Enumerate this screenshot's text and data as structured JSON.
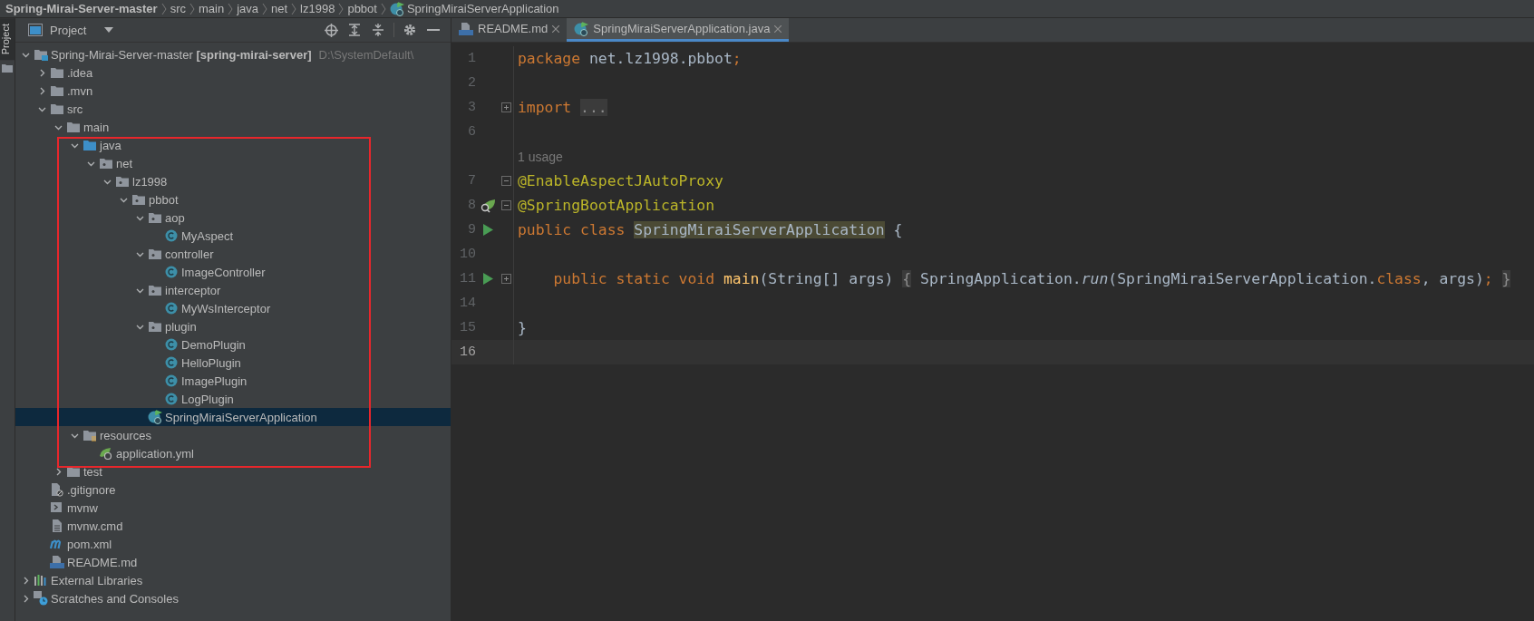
{
  "breadcrumb": [
    {
      "label": "Spring-Mirai-Server-master",
      "bold": true,
      "kind": "text"
    },
    {
      "label": "src",
      "bold": false,
      "kind": "text"
    },
    {
      "label": "main",
      "bold": false,
      "kind": "text"
    },
    {
      "label": "java",
      "bold": false,
      "kind": "text"
    },
    {
      "label": "net",
      "bold": false,
      "kind": "text"
    },
    {
      "label": "lz1998",
      "bold": false,
      "kind": "text"
    },
    {
      "label": "pbbot",
      "bold": false,
      "kind": "text"
    },
    {
      "label": "SpringMiraiServerApplication",
      "bold": false,
      "kind": "spring-class"
    }
  ],
  "side_strip": {
    "tabs": [
      {
        "label": "Project",
        "selected": true
      }
    ]
  },
  "project_panel": {
    "title": "Project",
    "tree": [
      {
        "label": "Spring-Mirai-Server-master **[spring-mirai-server]**",
        "path": "D:\\SystemDefault\\",
        "kind": "module",
        "expanded": true,
        "selected": false,
        "children": [
          {
            "label": ".idea",
            "kind": "folder",
            "expanded": false,
            "selected": false
          },
          {
            "label": ".mvn",
            "kind": "folder",
            "expanded": false,
            "selected": false
          },
          {
            "label": "src",
            "kind": "folder",
            "expanded": true,
            "selected": false,
            "children": [
              {
                "label": "main",
                "kind": "folder",
                "expanded": true,
                "selected": false,
                "outlined": true,
                "children": [
                  {
                    "label": "java",
                    "kind": "source-folder",
                    "expanded": true,
                    "selected": false,
                    "children": [
                      {
                        "label": "net",
                        "kind": "package",
                        "expanded": true,
                        "selected": false,
                        "children": [
                          {
                            "label": "lz1998",
                            "kind": "package",
                            "expanded": true,
                            "selected": false,
                            "children": [
                              {
                                "label": "pbbot",
                                "kind": "package",
                                "expanded": true,
                                "selected": false,
                                "children": [
                                  {
                                    "label": "aop",
                                    "kind": "package",
                                    "expanded": true,
                                    "selected": false,
                                    "children": [
                                      {
                                        "label": "MyAspect",
                                        "kind": "class",
                                        "selected": false
                                      }
                                    ]
                                  },
                                  {
                                    "label": "controller",
                                    "kind": "package",
                                    "expanded": true,
                                    "selected": false,
                                    "children": [
                                      {
                                        "label": "ImageController",
                                        "kind": "class",
                                        "selected": false
                                      }
                                    ]
                                  },
                                  {
                                    "label": "interceptor",
                                    "kind": "package",
                                    "expanded": true,
                                    "selected": false,
                                    "children": [
                                      {
                                        "label": "MyWsInterceptor",
                                        "kind": "class",
                                        "selected": false
                                      }
                                    ]
                                  },
                                  {
                                    "label": "plugin",
                                    "kind": "package",
                                    "expanded": true,
                                    "selected": false,
                                    "children": [
                                      {
                                        "label": "DemoPlugin",
                                        "kind": "class",
                                        "selected": false
                                      },
                                      {
                                        "label": "HelloPlugin",
                                        "kind": "class",
                                        "selected": false
                                      },
                                      {
                                        "label": "ImagePlugin",
                                        "kind": "class",
                                        "selected": false
                                      },
                                      {
                                        "label": "LogPlugin",
                                        "kind": "class",
                                        "selected": false
                                      }
                                    ]
                                  },
                                  {
                                    "label": "SpringMiraiServerApplication",
                                    "kind": "spring-class",
                                    "selected": true
                                  }
                                ]
                              }
                            ]
                          }
                        ]
                      }
                    ]
                  },
                  {
                    "label": "resources",
                    "kind": "resources-folder",
                    "expanded": true,
                    "selected": false,
                    "children": [
                      {
                        "label": "application.yml",
                        "kind": "spring-config",
                        "selected": false
                      }
                    ]
                  }
                ]
              },
              {
                "label": "test",
                "kind": "folder",
                "expanded": false,
                "selected": false
              }
            ]
          },
          {
            "label": ".gitignore",
            "kind": "ignore-file",
            "selected": false
          },
          {
            "label": "mvnw",
            "kind": "script",
            "selected": false
          },
          {
            "label": "mvnw.cmd",
            "kind": "text-file",
            "selected": false
          },
          {
            "label": "pom.xml",
            "kind": "maven",
            "selected": false
          },
          {
            "label": "README.md",
            "kind": "markdown",
            "selected": false
          }
        ]
      },
      {
        "label": "External Libraries",
        "kind": "libraries",
        "expanded": false,
        "selected": false
      },
      {
        "label": "Scratches and Consoles",
        "kind": "scratches",
        "expanded": false,
        "selected": false
      }
    ]
  },
  "editor": {
    "tabs": [
      {
        "label": "README.md",
        "kind": "markdown",
        "selected": false
      },
      {
        "label": "SpringMiraiServerApplication.java",
        "kind": "spring-class",
        "selected": true
      }
    ],
    "lines": [
      {
        "kind": "code",
        "number": "1",
        "current": false,
        "tokens": [
          {
            "kind": "keyword",
            "text": "package"
          },
          {
            "kind": "plain",
            "text": " net.lz1998.pbbot"
          },
          {
            "kind": "keyword",
            "text": ";"
          }
        ]
      },
      {
        "kind": "code",
        "number": "2",
        "current": false
      },
      {
        "kind": "code",
        "number": "3",
        "current": false,
        "fold": {
          "kind": "expand"
        },
        "tokens": [
          {
            "kind": "keyword",
            "text": "import"
          },
          {
            "kind": "fold",
            "text": "..."
          }
        ]
      },
      {
        "kind": "code",
        "number": "6",
        "current": false
      },
      {
        "kind": "hint",
        "text": "1 usage"
      },
      {
        "kind": "code",
        "number": "7",
        "current": false,
        "fold": {
          "kind": "collapse"
        },
        "tokens": [
          {
            "kind": "annotation",
            "text": "@EnableAspectJAutoProxy"
          }
        ]
      },
      {
        "kind": "code",
        "number": "8",
        "current": false,
        "fold": {
          "kind": "collapse"
        },
        "marker": {
          "kind": "bean"
        },
        "tokens": [
          {
            "kind": "annotation",
            "text": "@SpringBootApplication"
          }
        ]
      },
      {
        "kind": "code",
        "number": "9",
        "current": false,
        "marker": {
          "kind": "run"
        },
        "tokens": [
          {
            "kind": "keyword",
            "text": "public class "
          },
          {
            "kind": "highlight",
            "text": "SpringMiraiServerApplication"
          },
          {
            "kind": "plain",
            "text": " {"
          }
        ]
      },
      {
        "kind": "code",
        "number": "10",
        "current": false
      },
      {
        "kind": "code",
        "number": "11",
        "current": false,
        "fold": {
          "kind": "expand"
        },
        "marker": {
          "kind": "run"
        },
        "tokens": [
          {
            "kind": "keyword",
            "text": "    public static void "
          },
          {
            "kind": "method",
            "text": "main"
          },
          {
            "kind": "plain",
            "text": "(String[] args)"
          },
          {
            "kind": "fold",
            "text": "{"
          },
          {
            "kind": "plain",
            "text": " SpringApplication."
          },
          {
            "kind": "call",
            "text": "run"
          },
          {
            "kind": "plain",
            "text": "(SpringMiraiServerApplication."
          },
          {
            "kind": "keyword",
            "text": "class"
          },
          {
            "kind": "plain",
            "text": ", args)"
          },
          {
            "kind": "keyword",
            "text": ";"
          },
          {
            "kind": "fold",
            "text": "}"
          }
        ]
      },
      {
        "kind": "code",
        "number": "14",
        "current": false
      },
      {
        "kind": "code",
        "number": "15",
        "current": false,
        "tokens": [
          {
            "kind": "plain",
            "text": "}"
          }
        ]
      },
      {
        "kind": "code",
        "number": "16",
        "current": true
      }
    ]
  }
}
